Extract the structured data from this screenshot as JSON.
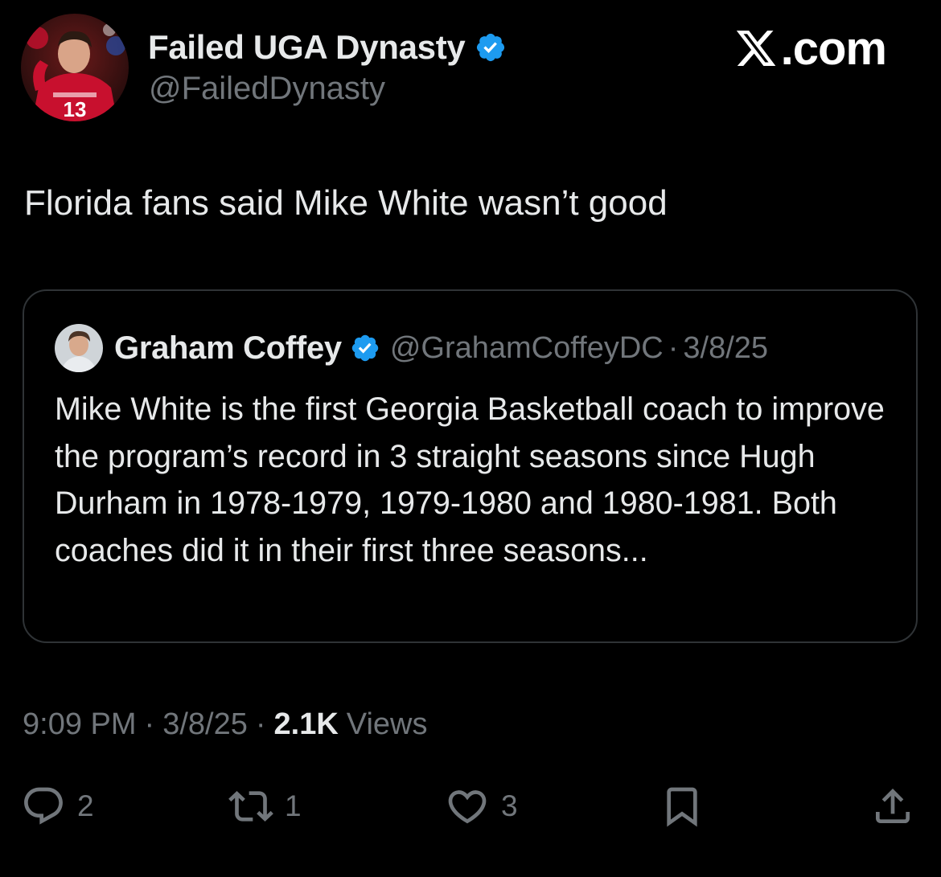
{
  "author": {
    "name": "Failed UGA Dynasty",
    "handle": "@FailedDynasty",
    "avatar_jersey_number": "13"
  },
  "brand": {
    "wordmark": ".com"
  },
  "tweet": {
    "text": "Florida fans said Mike White wasn’t good"
  },
  "quoted_tweet": {
    "name": "Graham Coffey",
    "handle": "@GrahamCoffeyDC",
    "separator": "·",
    "date": "3/8/25",
    "text": "Mike White is the first Georgia Basketball coach to improve the program’s record in 3 straight seasons since Hugh Durham in 1978-1979, 1979-1980 and 1980-1981. Both coaches did it in their first three seasons..."
  },
  "meta": {
    "time": "9:09 PM",
    "separator": "·",
    "date": "3/8/25",
    "views_count": "2.1K",
    "views_label": "Views"
  },
  "actions": {
    "replies": "2",
    "reposts": "1",
    "likes": "3"
  },
  "colors": {
    "background": "#000000",
    "primary_text": "#e7e9ea",
    "secondary_text": "#71767b",
    "border": "#2f3336",
    "verified": "#1d9bf0",
    "avatar_jersey": "#c8102e"
  },
  "icons": [
    "verified-badge-icon",
    "x-logo-icon",
    "reply-icon",
    "retweet-icon",
    "like-icon",
    "bookmark-icon",
    "share-icon"
  ]
}
